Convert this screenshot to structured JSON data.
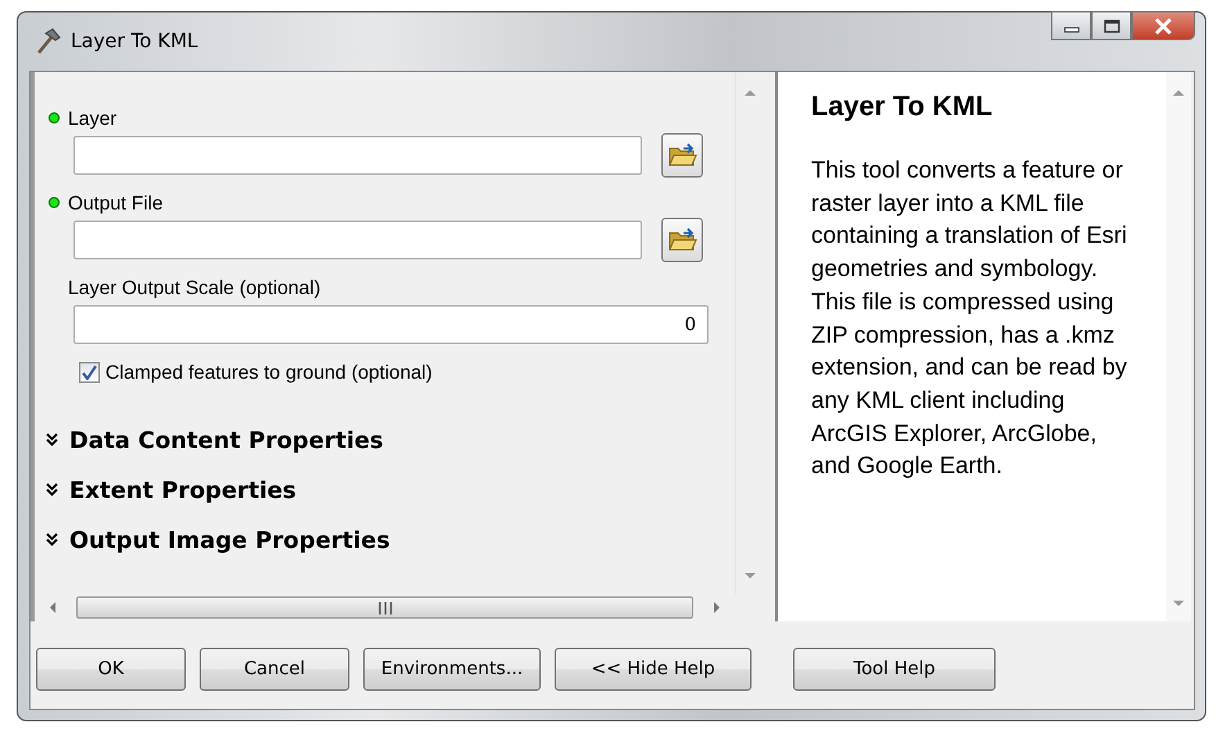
{
  "window": {
    "title": "Layer To KML"
  },
  "parameters": [
    {
      "kind": "path",
      "label": "Layer",
      "required": true
    },
    {
      "kind": "path",
      "label": "Output File",
      "required": true
    },
    {
      "kind": "number",
      "label": "Layer Output Scale (optional)",
      "required": false,
      "value": "0"
    },
    {
      "kind": "checkbox",
      "label": "Clamped features to ground (optional)",
      "checked": true
    }
  ],
  "sections": [
    {
      "label": "Data Content Properties",
      "expanded": false
    },
    {
      "label": "Extent Properties",
      "expanded": false
    },
    {
      "label": "Output Image Properties",
      "expanded": false
    }
  ],
  "buttons": [
    "OK",
    "Cancel",
    "Environments...",
    "<< Hide Help"
  ],
  "help": {
    "title": "Layer To KML",
    "body": "This tool converts a feature or raster layer into a KML file containing a translation of Esri geometries and symbology. This file is compressed using ZIP compression, has a .kmz extension, and can be read by any KML client including ArcGIS Explorer, ArcGlobe, and Google Earth.",
    "button": "Tool Help"
  }
}
